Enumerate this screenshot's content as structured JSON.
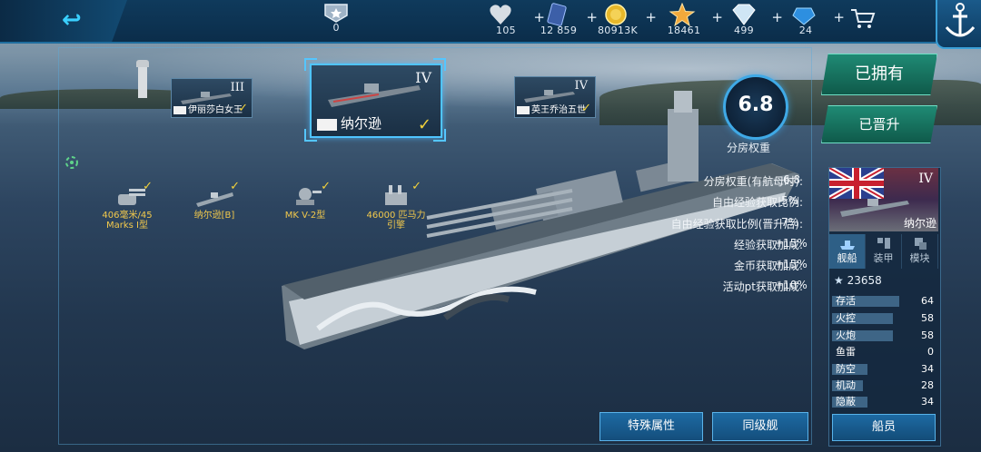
{
  "topbar": {
    "rank_value": "0",
    "resources": [
      {
        "icon": "heart-icon",
        "value": "105",
        "has_plus": true
      },
      {
        "icon": "card-icon",
        "value": "12 859",
        "has_plus": true
      },
      {
        "icon": "gold-coin-icon",
        "value": "80913K",
        "has_plus": true
      },
      {
        "icon": "star-icon",
        "value": "18461",
        "has_plus": true
      },
      {
        "icon": "diamond-icon",
        "value": "499",
        "has_plus": true
      },
      {
        "icon": "blue-gem-icon",
        "value": "24",
        "has_plus": true
      }
    ]
  },
  "ship_cards": [
    {
      "tier": "III",
      "name": "伊丽莎白女王",
      "owned": true,
      "selected": false
    },
    {
      "tier": "IV",
      "name": "纳尔逊",
      "owned": true,
      "selected": true
    },
    {
      "tier": "IV",
      "name": "英王乔治五世",
      "owned": true,
      "selected": false
    }
  ],
  "rating": {
    "value": "6.8",
    "label": "分房权重"
  },
  "actions": {
    "owned": "已拥有",
    "promoted": "已晋升"
  },
  "upgrades": [
    {
      "label": "406毫米/45\nMarks I型",
      "icon": "turret-icon",
      "done": true
    },
    {
      "label": "纳尔逊[B]",
      "icon": "hull-icon",
      "done": true
    },
    {
      "label": "MK V-2型",
      "icon": "fire-control-icon",
      "done": true
    },
    {
      "label": "46000 匹马力\n引擎",
      "icon": "engine-icon",
      "done": true
    }
  ],
  "stats": [
    {
      "label": "分房权重(有航母时):",
      "value": "6.8"
    },
    {
      "label": "自由经验获取比例:",
      "value": "5%"
    },
    {
      "label": "自由经验获取比例(晋升后):",
      "value": "7%"
    },
    {
      "label": "经验获取加成:",
      "value": "+15%"
    },
    {
      "label": "金币获取加成:",
      "value": "+15%"
    },
    {
      "label": "活动pt获取加成:",
      "value": "+10%"
    }
  ],
  "bottom_buttons": {
    "special": "特殊属性",
    "same_tier": "同级舰"
  },
  "panel": {
    "tier": "IV",
    "name": "纳尔逊",
    "tabs": [
      {
        "label": "舰船",
        "icon": "ship-icon",
        "active": true
      },
      {
        "label": "装甲",
        "icon": "armor-icon",
        "active": false
      },
      {
        "label": "模块",
        "icon": "module-icon",
        "active": false
      }
    ],
    "power": "23658",
    "attributes": [
      {
        "label": "存活",
        "value": "64",
        "fill": 0.64
      },
      {
        "label": "火控",
        "value": "58",
        "fill": 0.58
      },
      {
        "label": "火炮",
        "value": "58",
        "fill": 0.58
      },
      {
        "label": "鱼雷",
        "value": "0",
        "fill": 0.0
      },
      {
        "label": "防空",
        "value": "34",
        "fill": 0.34
      },
      {
        "label": "机动",
        "value": "28",
        "fill": 0.28
      },
      {
        "label": "隐蔽",
        "value": "34",
        "fill": 0.34
      }
    ],
    "crew_button": "船员"
  }
}
